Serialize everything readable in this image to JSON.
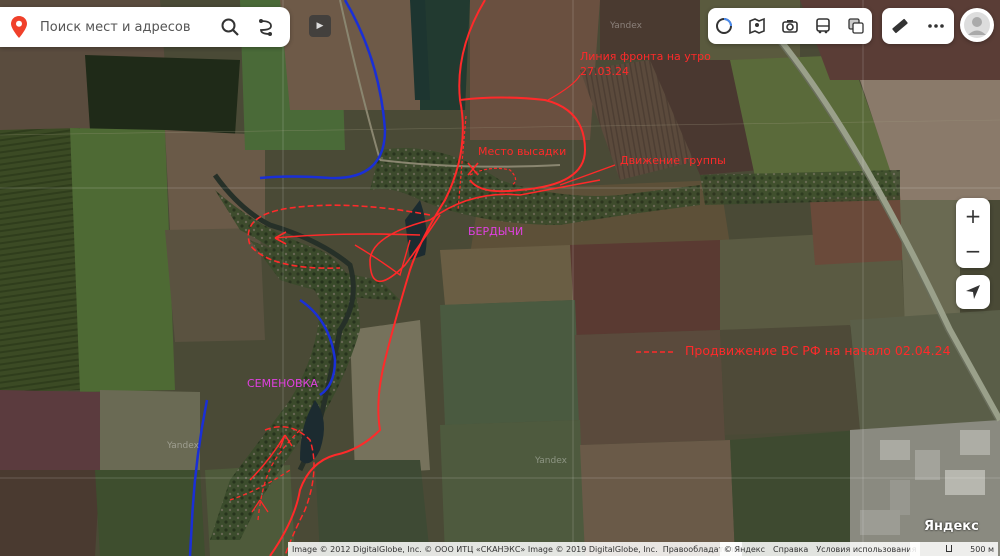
{
  "search": {
    "placeholder": "Поиск мест и адресов"
  },
  "map_labels": {
    "front_line": "Линия фронта на утро",
    "front_date": "27.03.24",
    "landing": "Место высадки",
    "movement": "Движение группы",
    "village1": "БЕРДЫЧИ",
    "village2": "СЕМЕНОВКА",
    "legend_advance": "Продвижение ВС РФ на начало 02.04.24",
    "watermark": "Yandex"
  },
  "logo": "Яндекс",
  "attribution": "Image © 2012 DigitalGlobe, Inc. © ООО ИТЦ «СКАНЭКС» Image © 2019 DigitalGlobe, Inc.",
  "rights_link": "Правообладатели",
  "links": {
    "copy": "© Яндекс",
    "help": "Справка",
    "terms": "Условия использования"
  },
  "scale_label": "500 м",
  "zoom": {
    "plus": "+",
    "minus": "−"
  },
  "colors": {
    "annotation": "#ff2a2a",
    "village": "#e040e0",
    "line_blue": "#1a2fd6"
  }
}
